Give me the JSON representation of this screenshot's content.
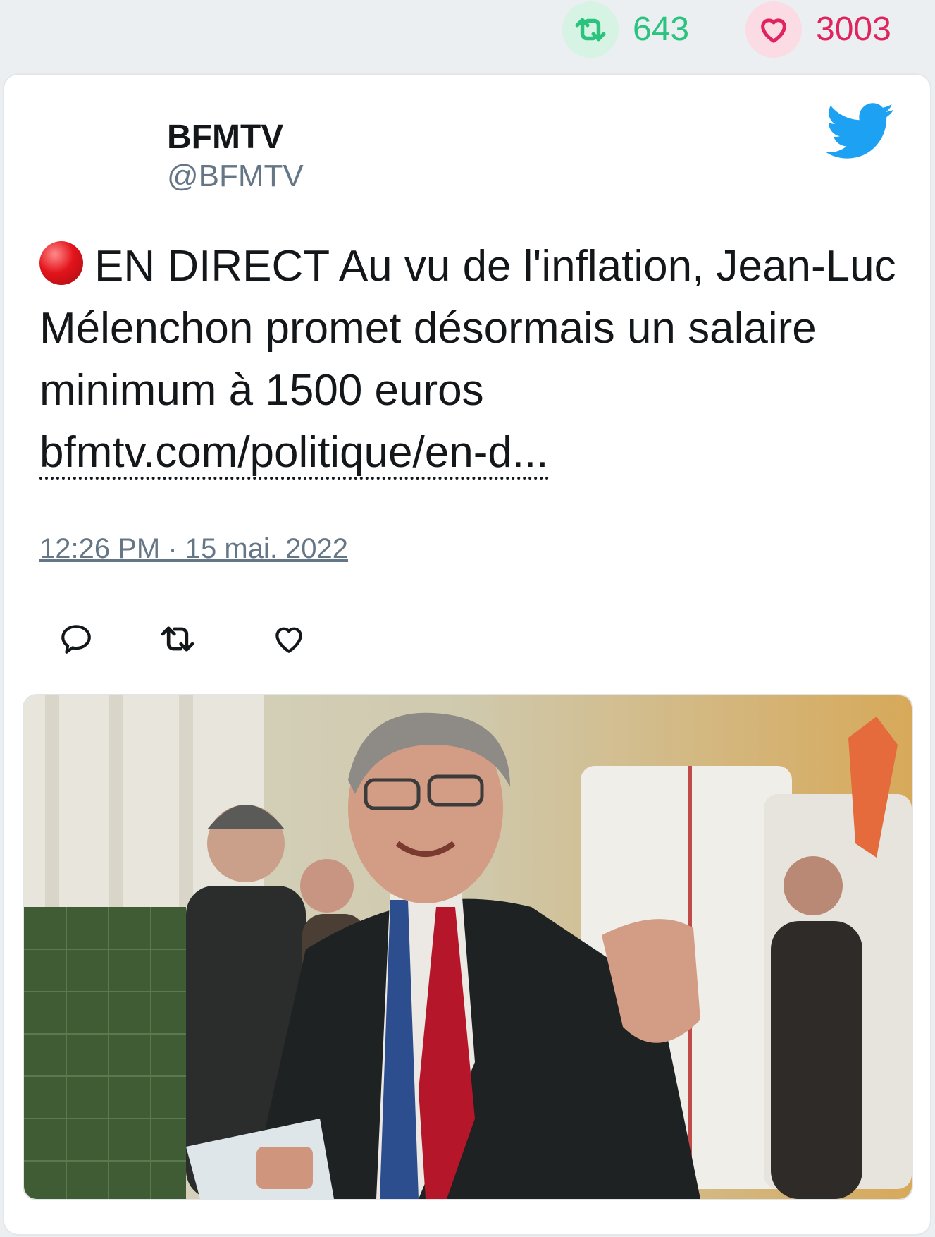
{
  "stats": {
    "retweets": "643",
    "likes": "3003",
    "retweet_color": "#2bc37f",
    "like_color": "#e0245e"
  },
  "tweet": {
    "author_name": "BFMTV",
    "author_handle": "@BFMTV",
    "live_emoji": "red-circle",
    "text": "EN DIRECT Au vu de l'inflation, Jean-Luc Mélenchon promet désormais un salaire minimum à 1500 euros",
    "link": "bfmtv.com/politique/en-d...",
    "timestamp": "12:26 PM · 15 mai. 2022"
  },
  "icons": {
    "brand": "twitter-bird-icon",
    "actions": [
      "reply-icon",
      "retweet-icon",
      "like-icon"
    ]
  },
  "colors": {
    "twitter_blue": "#1da1f2",
    "text": "#14171a",
    "muted": "#657786"
  }
}
